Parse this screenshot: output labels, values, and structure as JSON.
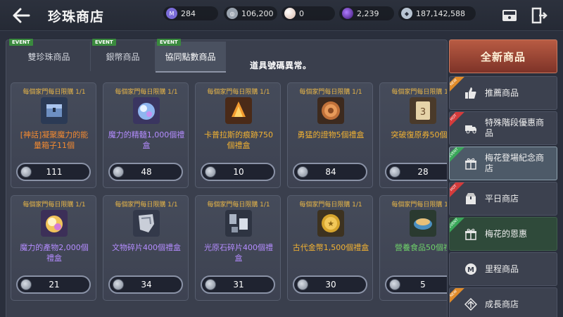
{
  "header": {
    "title": "珍珠商店",
    "currencies": [
      {
        "icon": "purple-gem-icon",
        "value": "284",
        "color": "#7a6cd8"
      },
      {
        "icon": "silver-coin-icon",
        "value": "106,200",
        "color": "#9aa3ae"
      },
      {
        "icon": "pearl-icon",
        "value": "0",
        "color": "#d9b8a8"
      },
      {
        "icon": "dark-orb-icon",
        "value": "2,239",
        "color": "#6b2fb8"
      },
      {
        "icon": "silver-droplet-icon",
        "value": "187,142,588",
        "color": "#b8c4d2"
      }
    ]
  },
  "tabs": [
    {
      "label": "雙珍珠商品",
      "badge": "EVENT"
    },
    {
      "label": "銀幣商品",
      "badge": "EVENT"
    },
    {
      "label": "協同點數商品",
      "badge": "EVENT"
    }
  ],
  "notice": "道具號碼異常。",
  "items": [
    {
      "limit": "每個家門每日限購 1/1",
      "name": "[神話]凝聚魔力的能\n量箱子11個",
      "price": "111",
      "color": "red",
      "icon": "chest-icon"
    },
    {
      "limit": "每個家門每日限購 1/1",
      "name": "魔力的精髓1,000個禮\n盒",
      "price": "48",
      "color": "purple",
      "icon": "crystal-orb-icon"
    },
    {
      "limit": "每個家門每日限購 1/1",
      "name": "卡普拉斯的痕跡750\n個禮盒",
      "price": "10",
      "color": "orange",
      "icon": "flame-relic-icon"
    },
    {
      "limit": "每個家門每日限購 1/1",
      "name": "勇猛的證物5個禮盒",
      "price": "84",
      "color": "orange",
      "icon": "bronze-medal-icon"
    },
    {
      "limit": "每個家門每日限購 1/1",
      "name": "突破復原券50個禮",
      "price": "28",
      "color": "orange",
      "icon": "scroll-ticket-icon"
    },
    {
      "limit": "每個家門每日限購 1/1",
      "name": "魔力的產物2,000個\n禮盒",
      "price": "21",
      "color": "purple",
      "icon": "glowing-orb-icon"
    },
    {
      "limit": "每個家門每日限購 1/1",
      "name": "文物碎片400個禮盒",
      "price": "34",
      "color": "purple",
      "icon": "artifact-shard-icon"
    },
    {
      "limit": "每個家門每日限購 1/1",
      "name": "光原石碎片400個禮\n盒",
      "price": "31",
      "color": "purple",
      "icon": "light-ore-icon"
    },
    {
      "limit": "每個家門每日限購 1/1",
      "name": "古代金幣1,500個禮盒",
      "price": "30",
      "color": "orange",
      "icon": "gold-coin-icon"
    },
    {
      "limit": "每個家門每日限購 1/1",
      "name": "營養食品50個禮",
      "price": "5",
      "color": "green",
      "icon": "food-bowl-icon"
    }
  ],
  "sidebar": {
    "header": "全新商品",
    "items": [
      {
        "label": "推薦商品",
        "ribbon": "NEW",
        "icon": "thumbs-up-icon"
      },
      {
        "label": "特殊階段優惠商\n品",
        "ribbon": "HOT",
        "icon": "truck-icon"
      },
      {
        "label": "梅花登場紀念商\n店",
        "ribbon": "EVENT",
        "icon": "gift-icon"
      },
      {
        "label": "平日商店",
        "ribbon": "HOT",
        "icon": "package-icon"
      },
      {
        "label": "梅花的恩惠",
        "ribbon": "EVENT",
        "icon": "gift-icon"
      },
      {
        "label": "里程商品",
        "ribbon": "",
        "icon": "mileage-m-icon"
      },
      {
        "label": "成長商店",
        "ribbon": "NEW",
        "icon": "growth-icon"
      }
    ]
  }
}
